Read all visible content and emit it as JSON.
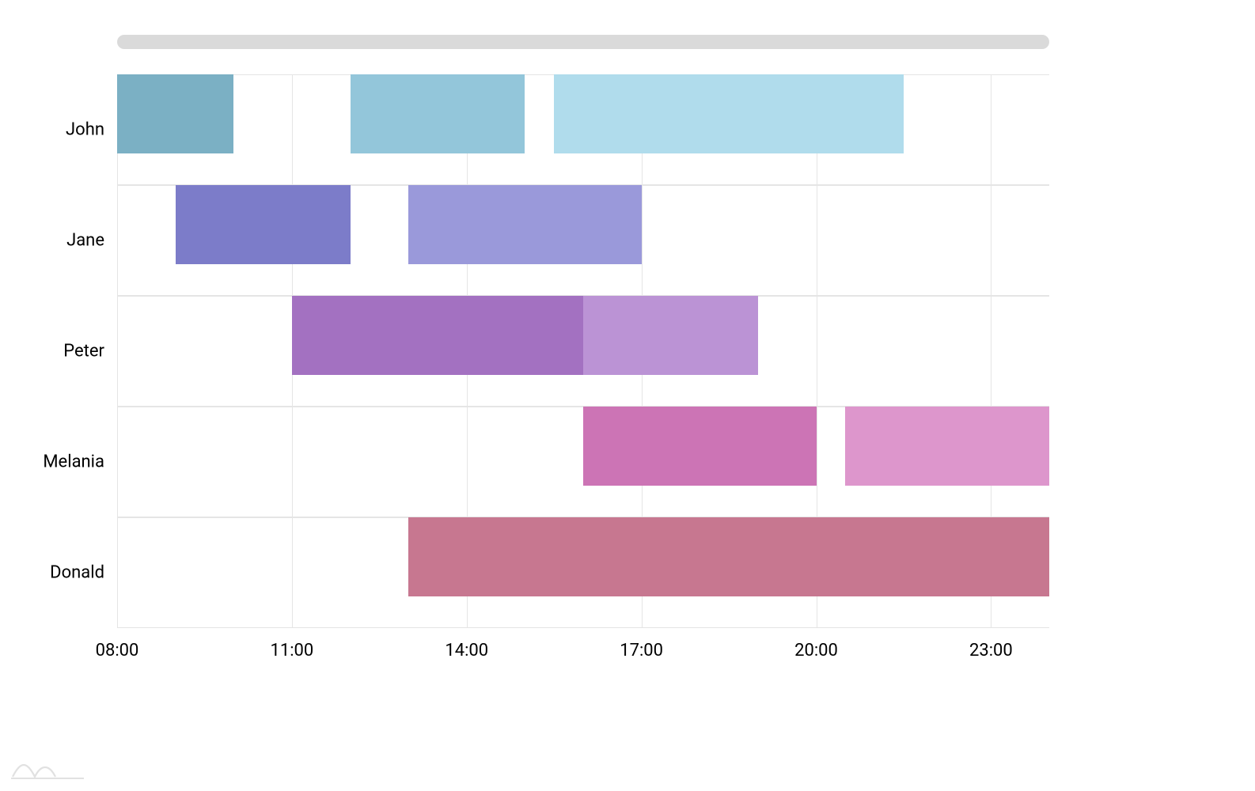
{
  "chart_data": {
    "type": "gantt",
    "x_axis": {
      "min": "08:00",
      "max": "24:00",
      "ticks": [
        "08:00",
        "11:00",
        "14:00",
        "17:00",
        "20:00",
        "23:00"
      ]
    },
    "categories": [
      "John",
      "Jane",
      "Peter",
      "Melania",
      "Donald"
    ],
    "series": [
      {
        "category": "John",
        "start": "08:00",
        "end": "10:00",
        "color": "#7bb0c4"
      },
      {
        "category": "John",
        "start": "12:00",
        "end": "15:00",
        "color": "#93c6da"
      },
      {
        "category": "John",
        "start": "15:30",
        "end": "21:30",
        "color": "#b0dcec"
      },
      {
        "category": "Jane",
        "start": "09:00",
        "end": "12:00",
        "color": "#7c7cc9"
      },
      {
        "category": "Jane",
        "start": "13:00",
        "end": "17:00",
        "color": "#9a99da"
      },
      {
        "category": "Peter",
        "start": "11:00",
        "end": "16:00",
        "color": "#a371c1"
      },
      {
        "category": "Peter",
        "start": "16:00",
        "end": "19:00",
        "color": "#bb93d5"
      },
      {
        "category": "Melania",
        "start": "16:00",
        "end": "20:00",
        "color": "#cc74b5"
      },
      {
        "category": "Melania",
        "start": "20:30",
        "end": "24:00",
        "color": "#dd96cc"
      },
      {
        "category": "Donald",
        "start": "13:00",
        "end": "24:00",
        "color": "#c77790"
      }
    ],
    "xlabel": "",
    "ylabel": "",
    "title": ""
  }
}
